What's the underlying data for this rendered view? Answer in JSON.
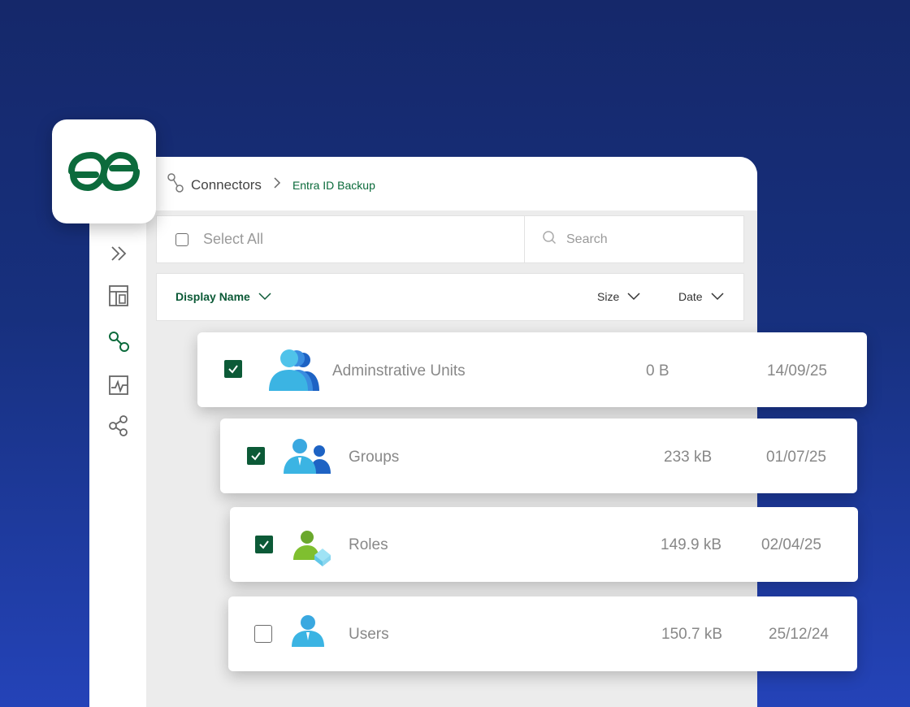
{
  "breadcrumb": {
    "root": "Connectors",
    "current": "Entra ID Backup"
  },
  "toolbar": {
    "select_all": "Select All",
    "search_placeholder": "Search"
  },
  "columns": {
    "name": "Display Name",
    "size": "Size",
    "date": "Date"
  },
  "sidebar": {
    "icons": [
      "expand-icon",
      "layout-icon",
      "connectors-icon",
      "activity-icon",
      "share-icon"
    ]
  },
  "rows": [
    {
      "name": "Adminstrative Units",
      "size": "0 B",
      "date": "14/09/25",
      "checked": true
    },
    {
      "name": "Groups",
      "size": "233 kB",
      "date": "01/07/25",
      "checked": true
    },
    {
      "name": "Roles",
      "size": "149.9 kB",
      "date": "02/04/25",
      "checked": true
    },
    {
      "name": "Users",
      "size": "150.7 kB",
      "date": "25/12/24",
      "checked": false
    }
  ],
  "colors": {
    "accent": "#0c5a37",
    "background": "#17307e"
  }
}
